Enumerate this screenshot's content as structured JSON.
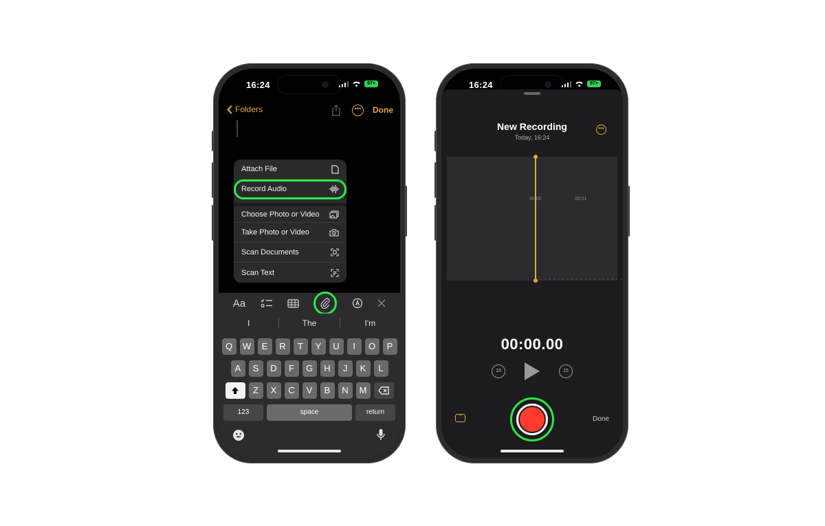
{
  "status_bar": {
    "time": "16:24",
    "battery": "97+"
  },
  "notes": {
    "back_label": "Folders",
    "done_label": "Done",
    "more_glyph": "•••",
    "attach_menu": [
      {
        "label": "Attach File",
        "icon": "doc-icon"
      },
      {
        "label": "Record Audio",
        "icon": "waveform-icon",
        "highlighted": true
      },
      {
        "label": "Choose Photo or Video",
        "icon": "photo-icon"
      },
      {
        "label": "Take Photo or Video",
        "icon": "camera-icon"
      },
      {
        "label": "Scan Documents",
        "icon": "doc-scanner-icon"
      },
      {
        "label": "Scan Text",
        "icon": "text-scanner-icon"
      }
    ],
    "format_bar": {
      "text_style_label": "Aa"
    },
    "suggestions": [
      "I",
      "The",
      "I'm"
    ],
    "keyboard": {
      "row1": [
        "Q",
        "W",
        "E",
        "R",
        "T",
        "Y",
        "U",
        "I",
        "O",
        "P"
      ],
      "row2": [
        "A",
        "S",
        "D",
        "F",
        "G",
        "H",
        "J",
        "K",
        "L"
      ],
      "row3": [
        "Z",
        "X",
        "C",
        "V",
        "B",
        "N",
        "M"
      ],
      "numbers_label": "123",
      "space_label": "space",
      "return_label": "return"
    }
  },
  "recording": {
    "title": "New Recording",
    "date": "Today, 16:24",
    "timeline_ticks": [
      "00:00",
      "00:01"
    ],
    "timer": "00:00.00",
    "skip_back_label": "15",
    "skip_forward_label": "15",
    "done_label": "Done",
    "more_glyph": "•••",
    "transcript_glyph": "\"\""
  },
  "colors": {
    "accent": "#e6a935",
    "highlight": "#2ee843",
    "record": "#ff3b30"
  }
}
